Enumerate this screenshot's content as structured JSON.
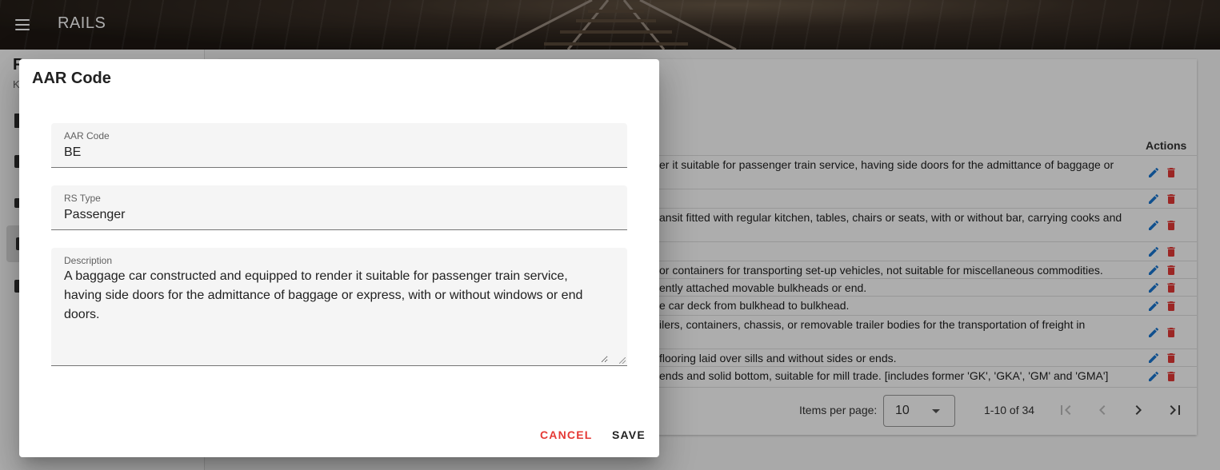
{
  "app": {
    "title": "RAILS"
  },
  "sidebar": {
    "title_partial": "R",
    "subtitle_partial": "K"
  },
  "table": {
    "actions_header": "Actions",
    "rows": [
      {
        "text": "er it suitable for passenger train service, having side doors for the admittance of baggage or"
      },
      {
        "text": ""
      },
      {
        "text": "ansit fitted with regular kitchen, tables, chairs or seats, with or without bar, carrying cooks and"
      },
      {
        "text": ""
      },
      {
        "text": "or containers for transporting set-up vehicles, not suitable for miscellaneous commodities."
      },
      {
        "text": "ently attached movable bulkheads or end."
      },
      {
        "text": "e car deck from bulkhead to bulkhead."
      },
      {
        "text": "ilers, containers, chassis, or removable trailer bodies for the transportation of freight in"
      },
      {
        "text": "flooring laid over sills and without sides or ends."
      },
      {
        "text": "ends and solid bottom, suitable for mill trade. [includes former 'GK', 'GKA', 'GM' and 'GMA']"
      }
    ]
  },
  "paginator": {
    "items_per_page_label": "Items per page:",
    "items_per_page_value": "10",
    "range_label": "1-10 of 34"
  },
  "dialog": {
    "title": "AAR Code",
    "fields": {
      "aar_code": {
        "label": "AAR Code",
        "value": "BE"
      },
      "rs_type": {
        "label": "RS Type",
        "value": "Passenger"
      },
      "description": {
        "label": "Description",
        "value": "A baggage car constructed and equipped to render it suitable for passenger train service, having side doors for the admittance of baggage or express, with or without windows or end doors."
      }
    },
    "cancel_label": "CANCEL",
    "save_label": "SAVE"
  },
  "colors": {
    "edit": "#1976d2",
    "delete": "#e53935",
    "cancel": "#e53935"
  }
}
